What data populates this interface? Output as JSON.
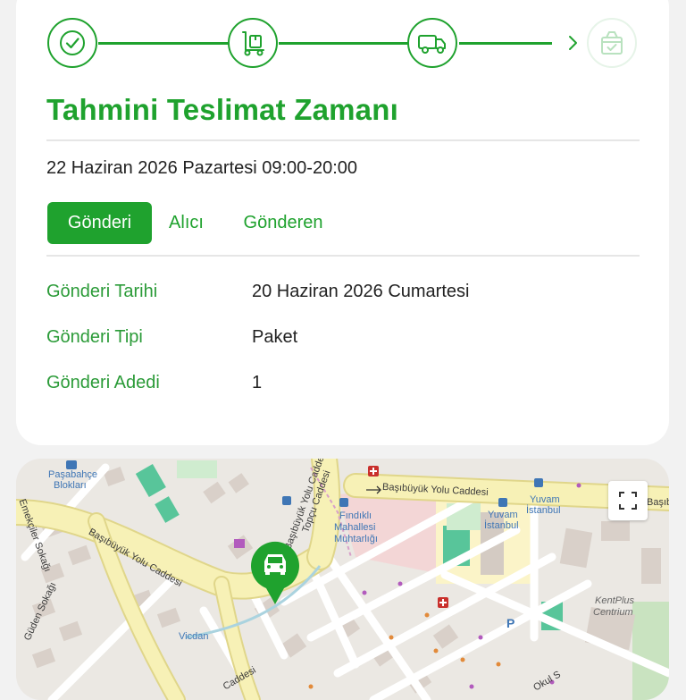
{
  "steps": [
    {
      "icon": "check-icon",
      "state": "done"
    },
    {
      "icon": "hand-truck-icon",
      "state": "done"
    },
    {
      "icon": "delivery-truck-icon",
      "state": "current"
    },
    {
      "icon": "package-check-icon",
      "state": "pending"
    }
  ],
  "title": "Tahmini Teslimat Zamanı",
  "delivery_window": "22 Haziran 2026 Pazartesi 09:00-20:00",
  "tabs": [
    {
      "label": "Gönderi",
      "active": true
    },
    {
      "label": "Alıcı",
      "active": false
    },
    {
      "label": "Gönderen",
      "active": false
    }
  ],
  "details": [
    {
      "label": "Gönderi Tarihi",
      "value": "20 Haziran 2026 Cumartesi"
    },
    {
      "label": "Gönderi Tipi",
      "value": "Paket"
    },
    {
      "label": "Gönderi Adedi",
      "value": "1"
    }
  ],
  "map": {
    "labels": {
      "pasabahce_1": "Paşabahçe",
      "pasabahce_2": "Blokları",
      "emekciler": "Emekçiler Sokağı",
      "yolu_caddesi_top": "Başıbüyük Yolu Caddesi",
      "topcu_caddesi": "Topçu Caddesi",
      "basibuyuk_left": "Başıbüyük Yolu Caddesi",
      "basibuyuk_right": "Başıbüyük Yolu Caddesi",
      "basibuyuk_edge": "Başıbüy",
      "findikli_1": "Fındıklı",
      "findikli_2": "Mahallesi",
      "findikli_3": "Muhtarlığı",
      "yuvam_1a": "Yuvam",
      "yuvam_1b": "İstanbul",
      "yuvam_2a": "Yuvam",
      "yuvam_2b": "İstanbul",
      "kentplus_1": "KentPlus",
      "kentplus_2": "Centrium",
      "guden": "Güden Sokağı",
      "vicdan": "Vicdan",
      "caddesi_bottom": "Caddesi",
      "okul": "Okul S",
      "parking": "P"
    }
  }
}
